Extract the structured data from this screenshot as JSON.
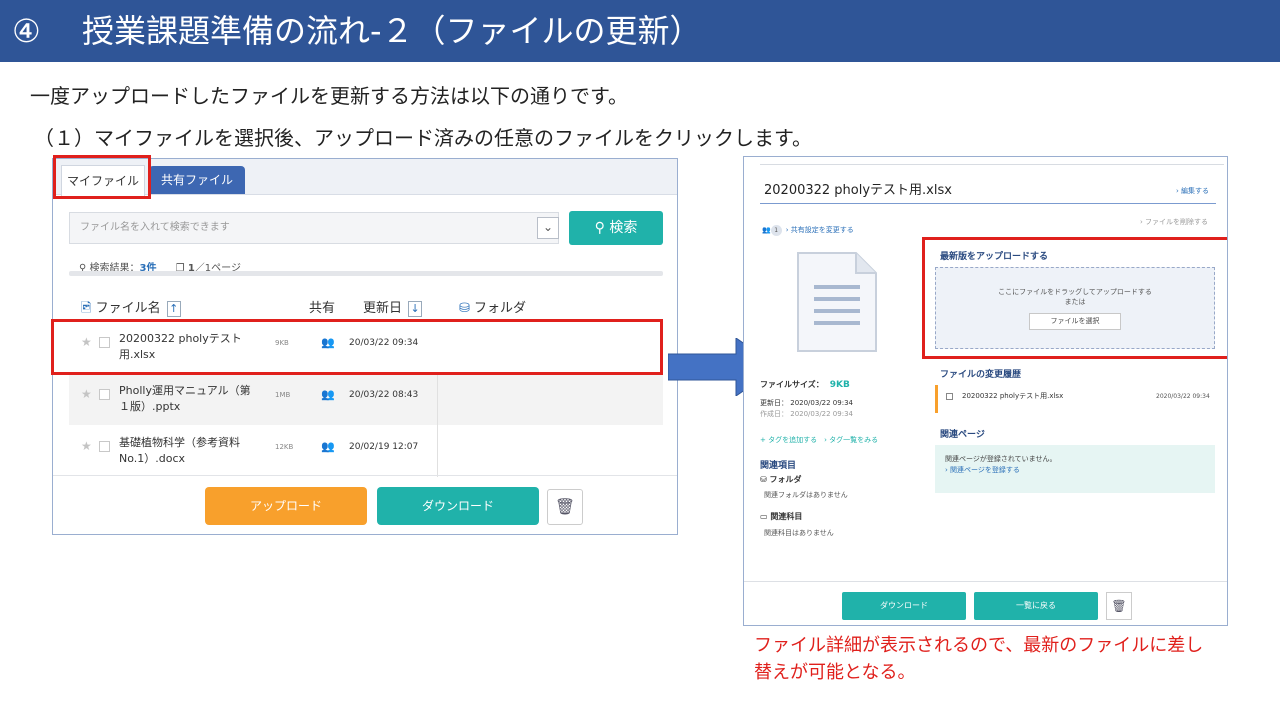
{
  "slide": {
    "title_number": "④",
    "title_text": "授業課題準備の流れ-２（ファイルの更新）",
    "line1": "一度アップロードしたファイルを更新する方法は以下の通りです。",
    "line2": "（１）マイファイルを選択後、アップロード済みの任意のファイルをクリックします。",
    "note": "ファイル詳細が表示されるので、最新のファイルに差し替えが可能となる。"
  },
  "colors": {
    "title_bar": "#2f5597",
    "highlight": "#e0201c",
    "teal": "#20b2aa",
    "orange": "#f8a02c",
    "tab_blue": "#3d67b2"
  },
  "file_list": {
    "tabs": {
      "my_files": "マイファイル",
      "shared_files": "共有ファイル"
    },
    "search_placeholder": "ファイル名を入れて検索できます",
    "search_button": "検索",
    "dropdown_icon": "chevron-down-icon",
    "result_label": "検索結果：",
    "result_count": "3件",
    "page_current": "1",
    "page_rest": "／1ページ",
    "headers": {
      "name": "ファイル名",
      "name_sort": "↑",
      "shared": "共有",
      "updated": "更新日",
      "updated_sort": "↓",
      "folder": "フォルダ"
    },
    "rows": [
      {
        "name": "20200322 pholyテスト用.xlsx",
        "size": "9KB",
        "date": "20/03/22 09:34"
      },
      {
        "name": "Pholly運用マニュアル（第１版）.pptx",
        "size": "1MB",
        "date": "20/03/22 08:43"
      },
      {
        "name": "基礎植物科学（参考資料No.1）.docx",
        "size": "12KB",
        "date": "20/02/19 12:07"
      }
    ],
    "upload_button": "アップロード",
    "download_button": "ダウンロード"
  },
  "file_detail": {
    "file_title": "20200322 pholyテスト用.xlsx",
    "edit_link": "› 編集する",
    "delete_link": "› ファイルを削除する",
    "share_count": "1",
    "share_link": "› 共有設定を変更する",
    "size_label": "ファイルサイズ：",
    "size_value": "9KB",
    "updated_label": "更新日：",
    "updated_value": "2020/03/22 09:34",
    "created_label": "作成日：",
    "created_value": "2020/03/22 09:34",
    "tag_links": "+ タグを追加する　› タグ一覧をみる",
    "related_heading": "関連項目",
    "folder_heading": "フォルダ",
    "folder_none": "関連フォルダはありません",
    "subject_heading": "関連科目",
    "subject_none": "関連科目はありません",
    "upload_heading": "最新版をアップロードする",
    "drop_text1": "ここにファイルをドラッグしてアップロードする",
    "drop_text2": "または",
    "select_button": "ファイルを選択",
    "history_heading": "ファイルの変更履歴",
    "history_name": "20200322 pholyテスト用.xlsx",
    "history_date": "2020/03/22 09:34",
    "related_pages_heading": "関連ページ",
    "related_pages_none": "関連ページが登録されていません。",
    "related_pages_link": "› 関連ページを登録する",
    "download_button": "ダウンロード",
    "back_button": "一覧に戻る"
  }
}
